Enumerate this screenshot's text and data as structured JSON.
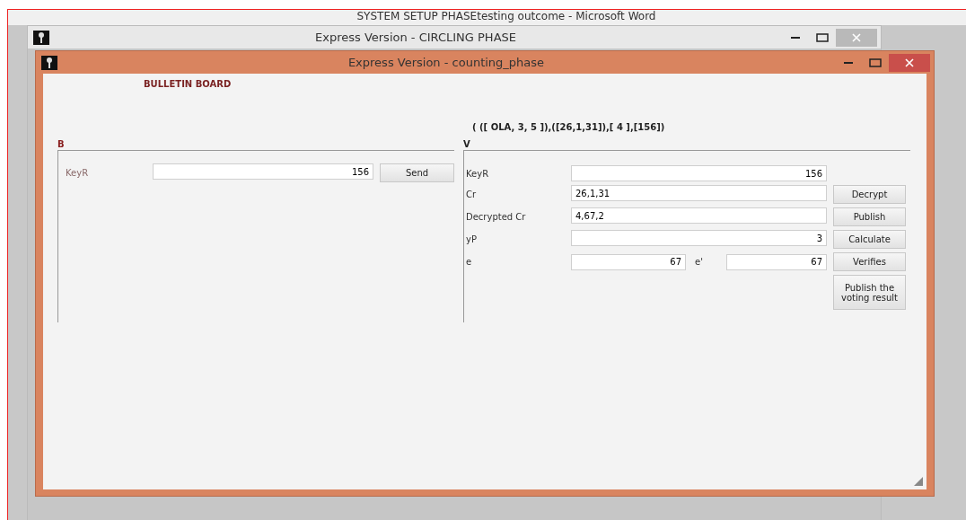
{
  "word_window": {
    "title": "SYSTEM SETUP PHASEtesting outcome  -  Microsoft Word"
  },
  "back_window": {
    "title": "Express Version - CIRCLING PHASE"
  },
  "window": {
    "title": "Express Version - counting_phase",
    "heading": "BULLETIN BOARD",
    "formula": "( ([ OLA, 3, 5 ]),([26,1,31]),[ 4 ],[156])",
    "groups": [
      {
        "title": "B",
        "rows": [
          {
            "label": "KeyR",
            "fields": [
              {
                "value": "156",
                "kind": "number"
              }
            ],
            "button": "Send"
          }
        ]
      },
      {
        "title": "V",
        "rows": [
          {
            "label": "KeyR",
            "fields": [
              {
                "value": "156",
                "kind": "number"
              }
            ]
          },
          {
            "label": "Cr",
            "fields": [
              {
                "value": "26,1,31",
                "kind": "text"
              }
            ],
            "button": "Decrypt"
          },
          {
            "label": "Decrypted Cr",
            "fields": [
              {
                "value": "4,67,2",
                "kind": "text"
              }
            ],
            "button": "Publish"
          },
          {
            "label": "yP",
            "fields": [
              {
                "value": "3",
                "kind": "number"
              }
            ],
            "button": "Calculate"
          },
          {
            "label": "e",
            "fields": [
              {
                "value": "67",
                "kind": "number"
              },
              {
                "label": "e'",
                "value": "67",
                "kind": "number"
              }
            ],
            "button": "Verifies"
          },
          {
            "button": "Publish the voting result"
          }
        ]
      }
    ]
  }
}
